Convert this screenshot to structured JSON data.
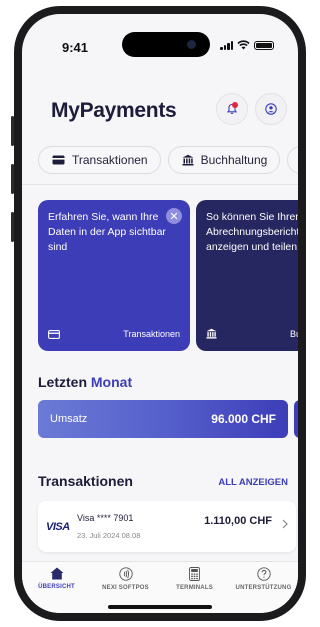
{
  "status_bar": {
    "time": "9:41"
  },
  "header": {
    "title": "MyPayments"
  },
  "chips": [
    {
      "label": "Transaktionen",
      "icon": "card-icon"
    },
    {
      "label": "Buchhaltung",
      "icon": "bank-icon"
    },
    {
      "label": "",
      "icon": "chart-icon"
    }
  ],
  "cards": [
    {
      "text": "Erfahren Sie, wann Ihre Daten in der App sichtbar sind",
      "footer": "Transaktionen"
    },
    {
      "text": "So können Sie Ihren Abrechnungsbericht anzeigen und teilen",
      "footer": "Buchhaltung"
    }
  ],
  "section": {
    "title_prefix": "Letzten",
    "title_accent": "Monat"
  },
  "umsatz": {
    "label": "Umsatz",
    "value": "96.000 CHF"
  },
  "transactions": {
    "title": "Transaktionen",
    "all_label": "ALL ANZEIGEN",
    "items": [
      {
        "brand": "VISA",
        "name": "Visa **** 7901",
        "date": "23. Juli 2024 08.08",
        "amount": "1.110,00 CHF"
      }
    ]
  },
  "nav": [
    {
      "label": "ÜBERSICHT",
      "icon": "home-icon",
      "active": true
    },
    {
      "label": "NEXI SOFTPOS",
      "icon": "contactless-icon",
      "active": false
    },
    {
      "label": "TERMINALS",
      "icon": "terminal-icon",
      "active": false
    },
    {
      "label": "UNTERSTÜTZUNG",
      "icon": "help-icon",
      "active": false
    }
  ],
  "colors": {
    "accent": "#3d3db8",
    "dark_card": "#262660",
    "notification": "#e3243b"
  }
}
